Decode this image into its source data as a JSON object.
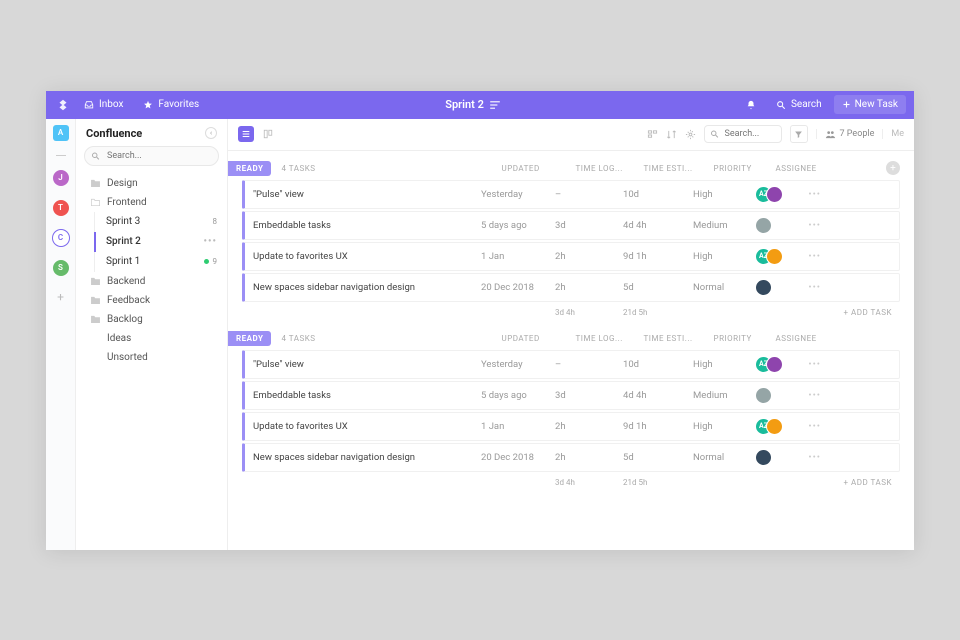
{
  "topbar": {
    "inbox_label": "Inbox",
    "favorites_label": "Favorites",
    "title": "Sprint 2",
    "search_label": "Search",
    "new_task_label": "New Task"
  },
  "rail": {
    "items": [
      {
        "letter": "A",
        "color": "#4fc3f7",
        "shape": "square"
      },
      {
        "letter": "J",
        "color": "#ba68c8",
        "shape": "circle"
      },
      {
        "letter": "T",
        "color": "#ef5350",
        "shape": "circle"
      },
      {
        "letter": "C",
        "color": "#7b68ee",
        "shape": "circle",
        "active": true
      },
      {
        "letter": "S",
        "color": "#66bb6a",
        "shape": "circle"
      }
    ]
  },
  "sidebar": {
    "title": "Confluence",
    "search_placeholder": "Search...",
    "items": [
      {
        "label": "Design",
        "type": "folder"
      },
      {
        "label": "Frontend",
        "type": "folder-open",
        "children": [
          {
            "label": "Sprint 3",
            "count": "8"
          },
          {
            "label": "Sprint 2",
            "active": true,
            "menu": true
          },
          {
            "label": "Sprint 1",
            "count": "9",
            "dot": true
          }
        ]
      },
      {
        "label": "Backend",
        "type": "folder"
      },
      {
        "label": "Feedback",
        "type": "folder"
      },
      {
        "label": "Backlog",
        "type": "folder"
      },
      {
        "label": "Ideas",
        "type": "plain"
      },
      {
        "label": "Unsorted",
        "type": "plain"
      }
    ]
  },
  "main": {
    "search_placeholder": "Search...",
    "people_label": "7 People",
    "me_label": "Me",
    "columns": {
      "updated": "UPDATED",
      "time_log": "TIME LOG...",
      "time_est": "TIME ESTI...",
      "priority": "PRIORITY",
      "assignee": "ASSIGNEE"
    },
    "add_task_label": "+ ADD TASK",
    "groups": [
      {
        "status": "READY",
        "task_count": "4 TASKS",
        "totals": {
          "log": "3d 4h",
          "est": "21d 5h"
        },
        "show_add_col": true,
        "rows": [
          {
            "title": "\"Pulse\" view",
            "updated": "Yesterday",
            "log": "–",
            "est": "10d",
            "priority": "High",
            "assignees": [
              {
                "text": "AZ",
                "bg": "#1abc9c"
              },
              {
                "bg": "#8e44ad"
              }
            ]
          },
          {
            "title": "Embeddable tasks",
            "updated": "5 days ago",
            "log": "3d",
            "est": "4d 4h",
            "priority": "Medium",
            "assignees": [
              {
                "bg": "#95a5a6"
              }
            ]
          },
          {
            "title": "Update to favorites UX",
            "updated": "1 Jan",
            "log": "2h",
            "est": "9d 1h",
            "priority": "High",
            "assignees": [
              {
                "text": "AZ",
                "bg": "#1abc9c"
              },
              {
                "bg": "#f39c12"
              }
            ]
          },
          {
            "title": "New spaces sidebar navigation design",
            "updated": "20 Dec 2018",
            "log": "2h",
            "est": "5d",
            "priority": "Normal",
            "assignees": [
              {
                "bg": "#34495e"
              }
            ]
          }
        ]
      },
      {
        "status": "READY",
        "task_count": "4 TASKS",
        "totals": {
          "log": "3d 4h",
          "est": "21d 5h"
        },
        "show_add_col": false,
        "rows": [
          {
            "title": "\"Pulse\" view",
            "updated": "Yesterday",
            "log": "–",
            "est": "10d",
            "priority": "High",
            "assignees": [
              {
                "text": "AZ",
                "bg": "#1abc9c"
              },
              {
                "bg": "#8e44ad"
              }
            ]
          },
          {
            "title": "Embeddable tasks",
            "updated": "5 days ago",
            "log": "3d",
            "est": "4d 4h",
            "priority": "Medium",
            "assignees": [
              {
                "bg": "#95a5a6"
              }
            ]
          },
          {
            "title": "Update to favorites UX",
            "updated": "1 Jan",
            "log": "2h",
            "est": "9d 1h",
            "priority": "High",
            "assignees": [
              {
                "text": "AZ",
                "bg": "#1abc9c"
              },
              {
                "bg": "#f39c12"
              }
            ]
          },
          {
            "title": "New spaces sidebar navigation design",
            "updated": "20 Dec 2018",
            "log": "2h",
            "est": "5d",
            "priority": "Normal",
            "assignees": [
              {
                "bg": "#34495e"
              }
            ]
          }
        ]
      }
    ]
  }
}
